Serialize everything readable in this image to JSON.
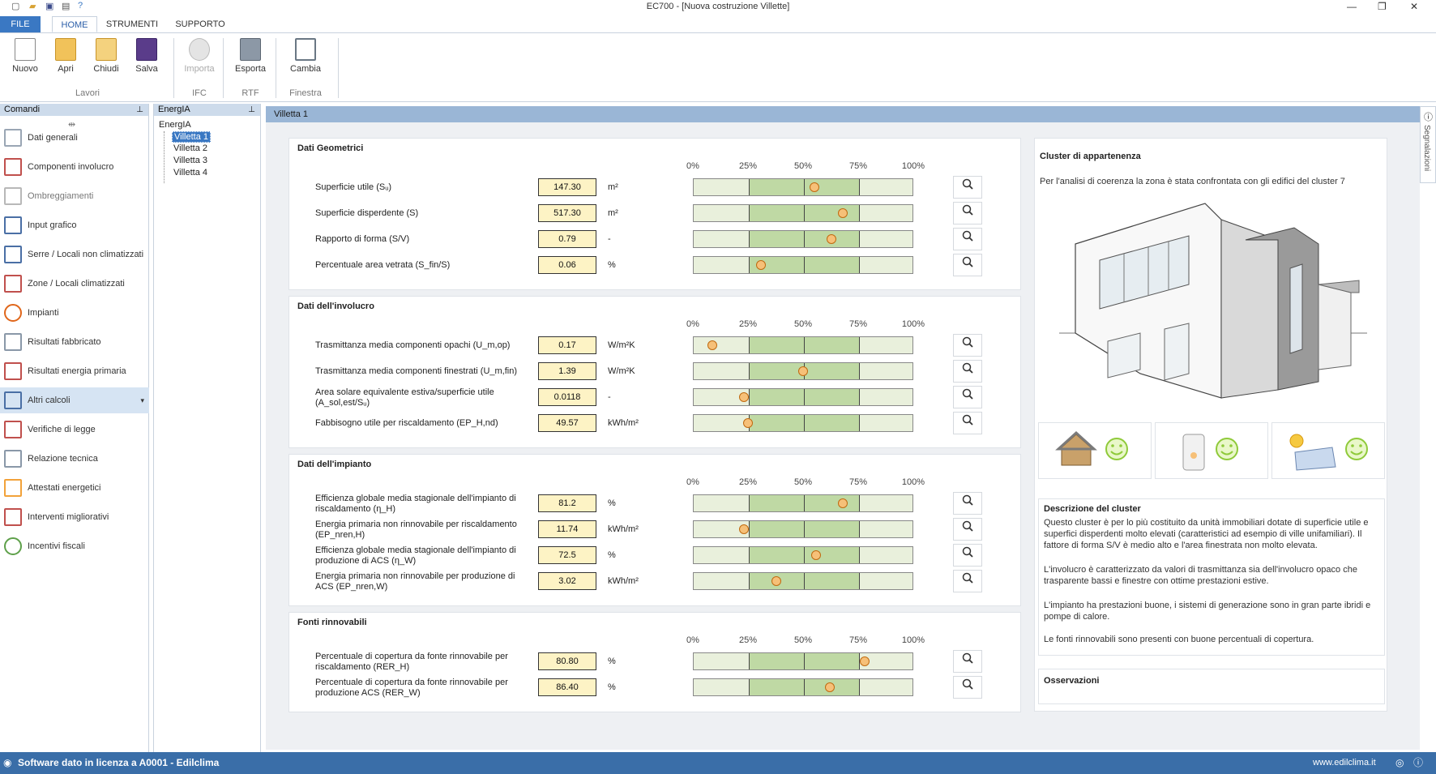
{
  "window": {
    "title": "EC700 - [Nuova costruzione Villette]"
  },
  "ribbon": {
    "tabs": [
      "FILE",
      "HOME",
      "STRUMENTI",
      "SUPPORTO"
    ],
    "buttons": {
      "nuovo": "Nuovo",
      "apri": "Apri",
      "chiudi": "Chiudi",
      "salva": "Salva",
      "importa": "Importa",
      "esporta": "Esporta",
      "cambia": "Cambia"
    },
    "groups": {
      "lavori": "Lavori",
      "ifc": "IFC",
      "rtf": "RTF",
      "finestra": "Finestra"
    }
  },
  "commands": {
    "header": "Comandi",
    "items": [
      "Dati generali",
      "Componenti involucro",
      "Ombreggiamenti",
      "Input grafico",
      "Serre / Locali non climatizzati",
      "Zone / Locali climatizzati",
      "Impianti",
      "Risultati fabbricato",
      "Risultati energia primaria",
      "Altri calcoli",
      "Verifiche di legge",
      "Relazione tecnica",
      "Attestati energetici",
      "Interventi migliorativi",
      "Incentivi fiscali"
    ]
  },
  "tree": {
    "header": "EnergIA",
    "root": "EnergIA",
    "nodes": [
      "Villetta 1",
      "Villetta 2",
      "Villetta 3",
      "Villetta 4"
    ]
  },
  "main": {
    "header": "Villetta 1",
    "pct_labels": [
      "0%",
      "25%",
      "50%",
      "75%",
      "100%"
    ],
    "sections": [
      {
        "title": "Dati Geometrici",
        "rows": [
          {
            "label": "Superficie utile (Sᵤ)",
            "value": "147.30",
            "unit": "m²",
            "fraction": 0.55
          },
          {
            "label": "Superficie disperdente (S)",
            "value": "517.30",
            "unit": "m²",
            "fraction": 0.68
          },
          {
            "label": "Rapporto di forma (S/V)",
            "value": "0.79",
            "unit": "-",
            "fraction": 0.63
          },
          {
            "label": "Percentuale area vetrata (S_fin/S)",
            "value": "0.06",
            "unit": "%",
            "fraction": 0.31
          }
        ]
      },
      {
        "title": "Dati dell'involucro",
        "rows": [
          {
            "label": "Trasmittanza media componenti opachi (U_m,op)",
            "value": "0.17",
            "unit": "W/m²K",
            "fraction": 0.09
          },
          {
            "label": "Trasmittanza media componenti finestrati (U_m,fin)",
            "value": "1.39",
            "unit": "W/m²K",
            "fraction": 0.5
          },
          {
            "label": "Area solare equivalente estiva/superficie utile (A_sol,est/Sᵤ)",
            "value": "0.0118",
            "unit": "-",
            "fraction": 0.23
          },
          {
            "label": "Fabbisogno utile per riscaldamento (EP_H,nd)",
            "value": "49.57",
            "unit": "kWh/m²",
            "fraction": 0.25
          }
        ]
      },
      {
        "title": "Dati dell'impianto",
        "rows": [
          {
            "label": "Efficienza globale media stagionale dell'impianto di riscaldamento (η_H)",
            "value": "81.2",
            "unit": "%",
            "fraction": 0.68
          },
          {
            "label": "Energia primaria non rinnovabile per riscaldamento (EP_nren,H)",
            "value": "11.74",
            "unit": "kWh/m²",
            "fraction": 0.23
          },
          {
            "label": "Efficienza globale media stagionale dell'impianto di produzione di ACS (η_W)",
            "value": "72.5",
            "unit": "%",
            "fraction": 0.56
          },
          {
            "label": "Energia primaria non rinnovabile per produzione di ACS (EP_nren,W)",
            "value": "3.02",
            "unit": "kWh/m²",
            "fraction": 0.38
          }
        ]
      },
      {
        "title": "Fonti rinnovabili",
        "rows": [
          {
            "label": "Percentuale di copertura da fonte rinnovabile per riscaldamento (RER_H)",
            "value": "80.80",
            "unit": "%",
            "fraction": 0.78
          },
          {
            "label": "Percentuale di copertura da fonte rinnovabile per produzione ACS (RER_W)",
            "value": "86.40",
            "unit": "%",
            "fraction": 0.62
          }
        ]
      }
    ]
  },
  "cluster": {
    "title": "Cluster di appartenenza",
    "intro": "Per l'analisi di coerenza la zona è stata confrontata con gli edifici del cluster 7",
    "desc_title": "Descrizione del cluster",
    "desc_p1": "Questo cluster è per lo più costituito da unità immobiliari dotate di superficie utile e superfici disperdenti molto elevati (caratteristici ad esempio di ville unifamiliari). Il fattore di forma S/V è medio alto e l'area finestrata non molto elevata.",
    "desc_p2": "L'involucro è caratterizzato da valori di trasmittanza sia dell'involucro opaco che trasparente bassi e finestre con ottime prestazioni estive.",
    "desc_p3": "L'impianto ha prestazioni buone, i sistemi di generazione sono in gran parte ibridi e pompe di calore.",
    "desc_p4": "Le fonti rinnovabili sono presenti con buone percentuali di copertura.",
    "oss_title": "Osservazioni"
  },
  "sidetab": "Segnalazioni",
  "status": {
    "license": "Software dato in licenza a A0001 - Edilclima",
    "site": "www.edilclima.it"
  },
  "colors": {
    "accent": "#3a78c3",
    "bar_mid": "#bfd9a4",
    "bar_side": "#e9f0dc",
    "dot": "#f6c078",
    "valbox": "#fdf3c5"
  }
}
